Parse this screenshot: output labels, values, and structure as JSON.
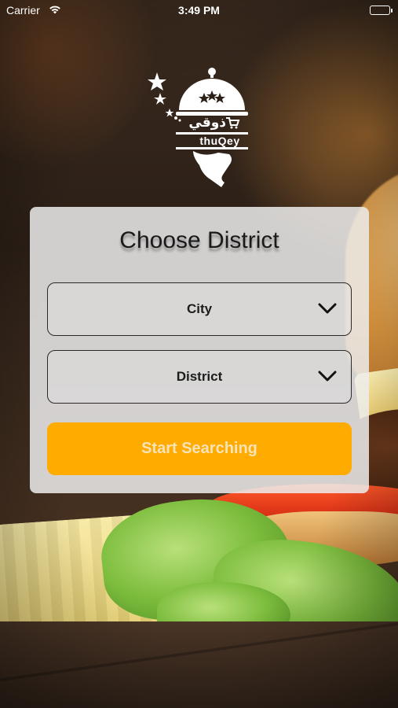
{
  "status_bar": {
    "carrier": "Carrier",
    "time": "3:49 PM",
    "icons": [
      "wifi-icon",
      "battery-icon"
    ]
  },
  "logo": {
    "arabic_text": "ذوقي",
    "brand_text": "thuQey"
  },
  "card": {
    "title": "Choose District",
    "city_dropdown": {
      "label": "City",
      "icon": "chevron-down-icon"
    },
    "district_dropdown": {
      "label": "District",
      "icon": "chevron-down-icon"
    },
    "search_button": {
      "label": "Start Searching"
    }
  },
  "colors": {
    "accent": "#FFAB00",
    "button_text": "#F6E3B8",
    "card_background": "#ECECEC"
  }
}
